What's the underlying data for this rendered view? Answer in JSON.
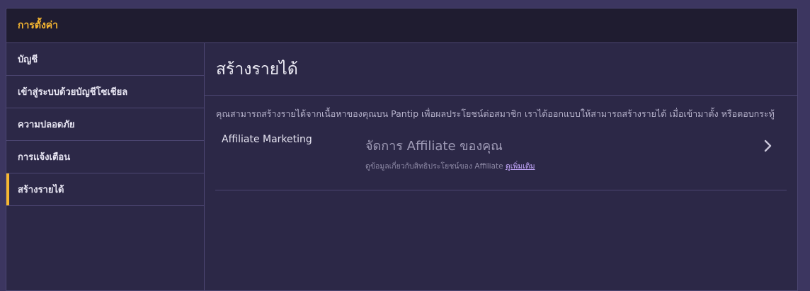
{
  "header": {
    "title": "การตั้งค่า"
  },
  "sidebar": {
    "items": [
      {
        "label": "บัญชี"
      },
      {
        "label": "เข้าสู่ระบบด้วยบัญชีโซเชียล"
      },
      {
        "label": "ความปลอดภัย"
      },
      {
        "label": "การแจ้งเตือน"
      },
      {
        "label": "สร้างรายได้"
      }
    ]
  },
  "content": {
    "title": "สร้างรายได้",
    "description": "คุณสามารถสร้างรายได้จากเนื้อหาของคุณบน Pantip เพื่อผลประโยชน์ต่อสมาชิก เราได้ออกแบบให้สามารถสร้างรายได้ เมื่อเข้ามาตั้ง หรือตอบกระทู้",
    "affiliate": {
      "label": "Affiliate Marketing",
      "title": "จัดการ Affiliate ของคุณ",
      "subtitle": "ดูข้อมูลเกี่ยวกับสิทธิประโยชน์ของ Affiliate",
      "link": "ดูเพิ่มเติม"
    }
  },
  "colors": {
    "accent": "#f7b731",
    "link": "#c6a9ff"
  },
  "icons": {
    "chevron": "chevron-right-icon"
  }
}
